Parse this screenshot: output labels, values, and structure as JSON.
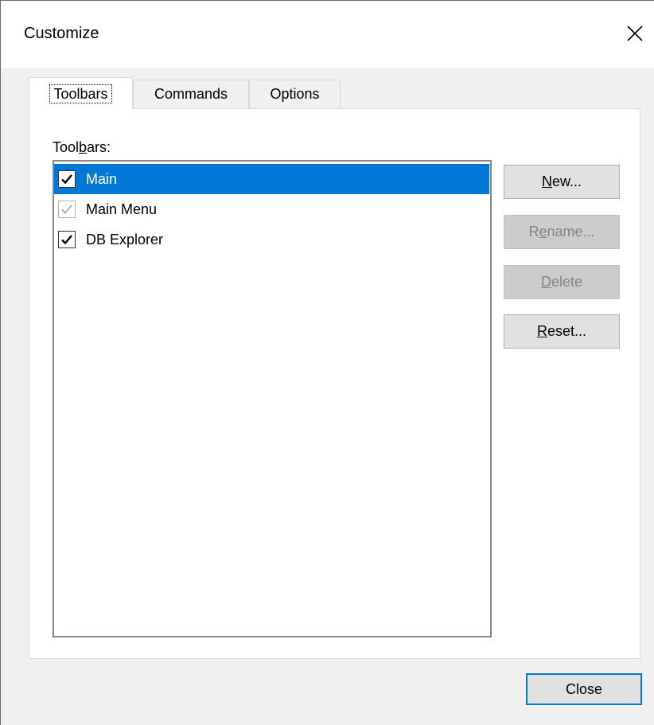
{
  "window": {
    "title": "Customize",
    "close_glyph": "close-icon"
  },
  "tabs": [
    {
      "label": "Toolbars",
      "active": true
    },
    {
      "label": "Commands",
      "active": false
    },
    {
      "label": "Options",
      "active": false
    }
  ],
  "toolbars_panel": {
    "label_pre": "Tool",
    "label_mnemonic": "b",
    "label_post": "ars:",
    "items": [
      {
        "label": "Main",
        "checked": true,
        "enabled": true,
        "selected": true
      },
      {
        "label": "Main Menu",
        "checked": true,
        "enabled": false,
        "selected": false
      },
      {
        "label": "DB Explorer",
        "checked": true,
        "enabled": true,
        "selected": false
      }
    ],
    "buttons": {
      "new": {
        "mnemonic": "N",
        "rest": "ew...",
        "enabled": true
      },
      "rename": {
        "pre": "R",
        "mnemonic": "e",
        "rest": "name...",
        "enabled": false
      },
      "delete": {
        "mnemonic": "D",
        "rest": "elete",
        "enabled": false
      },
      "reset": {
        "mnemonic": "R",
        "rest": "eset...",
        "enabled": true
      }
    }
  },
  "footer": {
    "close_label": "Close"
  },
  "colors": {
    "selection": "#0078d7",
    "dialog_bg": "#f0f0f0",
    "disabled_text": "#838383"
  }
}
